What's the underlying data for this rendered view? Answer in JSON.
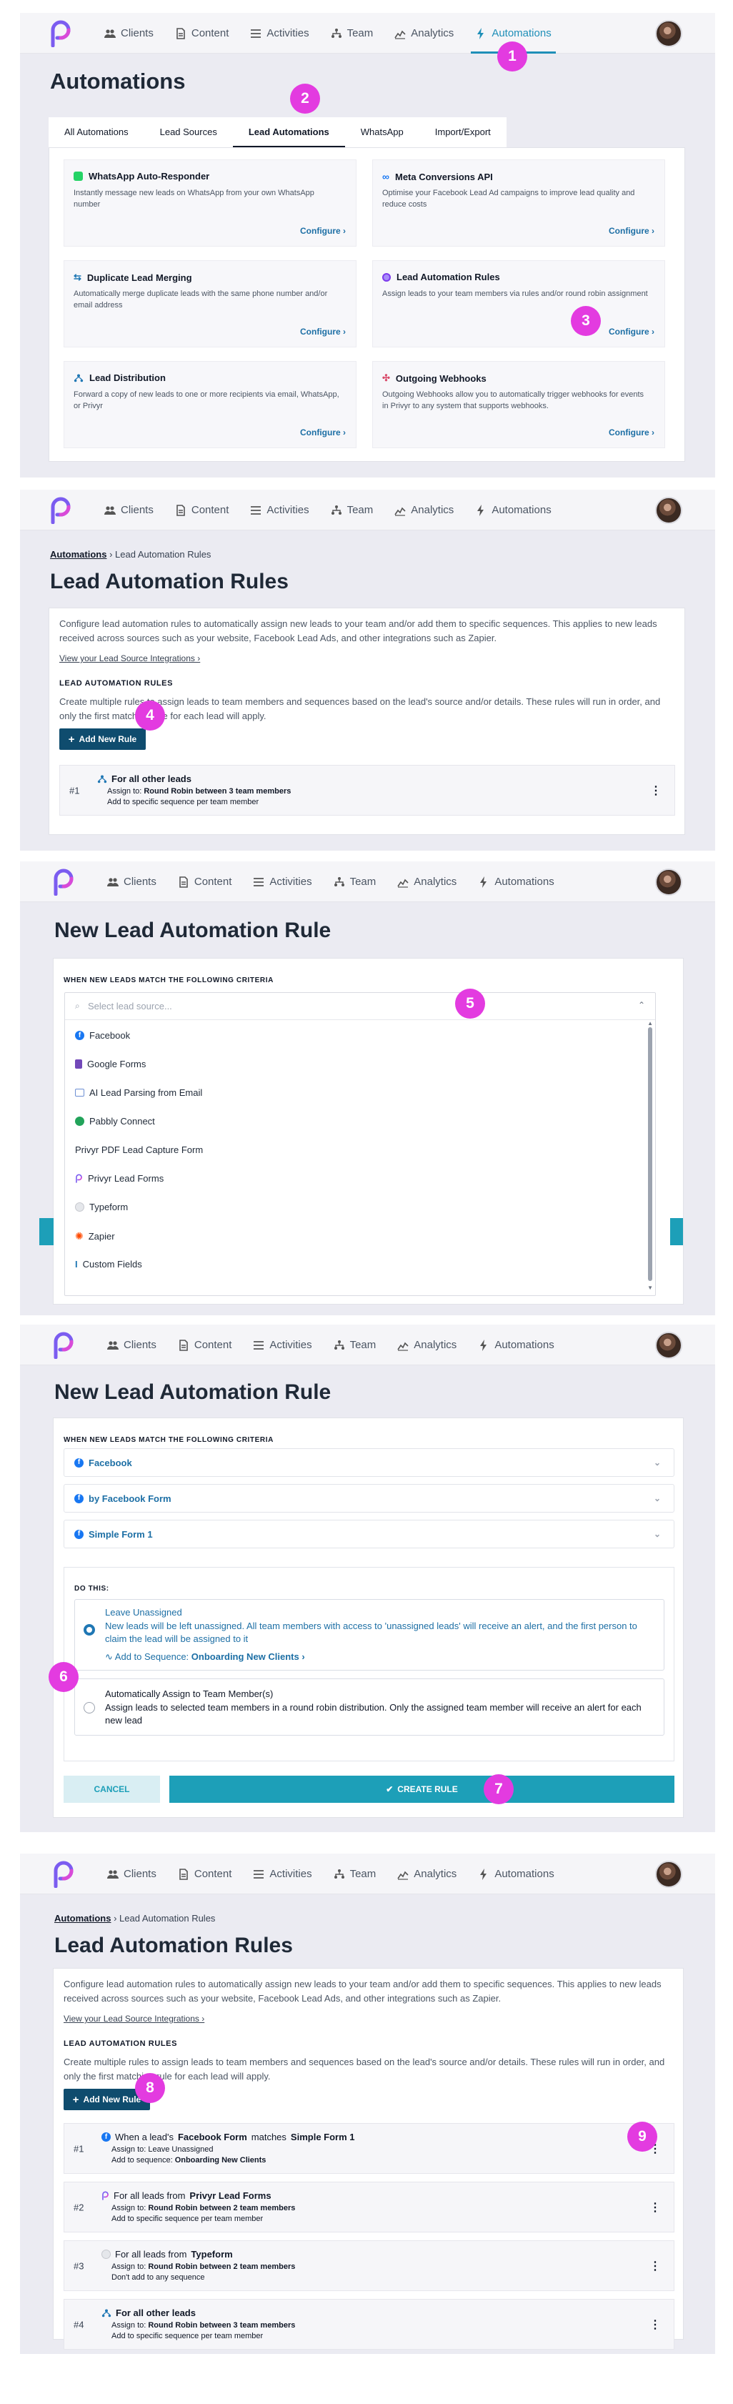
{
  "nav": {
    "items": [
      "Clients",
      "Content",
      "Activities",
      "Team",
      "Analytics",
      "Automations"
    ]
  },
  "screen1": {
    "title": "Automations",
    "tabs": [
      "All Automations",
      "Lead Sources",
      "Lead Automations",
      "WhatsApp",
      "Import/Export"
    ],
    "features": [
      {
        "title": "WhatsApp Auto-Responder",
        "desc": "Instantly message new leads on WhatsApp from your own WhatsApp number",
        "action": "Configure ›"
      },
      {
        "title": "Meta Conversions API",
        "desc": "Optimise your Facebook Lead Ad campaigns to improve lead quality and reduce costs",
        "action": "Configure ›"
      },
      {
        "title": "Duplicate Lead Merging",
        "desc": "Automatically merge duplicate leads with the same phone number and/or email address",
        "action": "Configure ›"
      },
      {
        "title": "Lead Automation Rules",
        "desc": "Assign leads to your team members via rules and/or round robin assignment",
        "action": "Configure ›"
      },
      {
        "title": "Lead Distribution",
        "desc": "Forward a copy of new leads to one or more recipients via email, WhatsApp, or Privyr",
        "action": "Configure ›"
      },
      {
        "title": "Outgoing Webhooks",
        "desc": "Outgoing Webhooks allow you to automatically trigger webhooks for events in Privyr to any system that supports webhooks.",
        "action": "Configure ›"
      }
    ]
  },
  "rules_page": {
    "crumb_root": "Automations",
    "crumb_current": " › Lead Automation Rules",
    "title": "Lead Automation Rules",
    "intro": "Configure lead automation rules to automatically assign new leads to your team and/or add them to specific sequences. This applies to new leads received across sources such as your website, Facebook Lead Ads, and other integrations such as Zapier.",
    "view_link": "View your Lead Source Integrations ›",
    "section_label": "LEAD AUTOMATION RULES",
    "section_desc": "Create multiple rules to assign leads to team members and sequences based on the lead's source and/or details. These rules will run in order, and only the first matching rule for each lead will apply.",
    "add_button": "Add New Rule"
  },
  "screen2": {
    "rules": [
      {
        "num": "#1",
        "title": "For all other leads",
        "assign_prefix": "Assign to: ",
        "assign": "Round Robin between 3 team members",
        "sequence": "Add to specific sequence per team member"
      }
    ]
  },
  "new_rule": {
    "title": "New Lead Automation Rule",
    "criteria_label": "WHEN NEW LEADS MATCH THE FOLLOWING CRITERIA",
    "select_placeholder": "Select lead source...",
    "sources": [
      "Facebook",
      "Google Forms",
      "AI Lead Parsing from Email",
      "Pabbly Connect",
      "Privyr PDF Lead Capture Form",
      "Privyr Lead Forms",
      "Typeform",
      "Zapier",
      "Custom Fields"
    ]
  },
  "screen4": {
    "selected": [
      "Facebook",
      "by Facebook Form",
      "Simple Form 1"
    ],
    "do_this": "DO THIS:",
    "option1_title": "Leave Unassigned",
    "option1_desc": "New leads will be left unassigned. All team members with access to 'unassigned leads' will receive an alert, and the first person to claim the lead will be assigned to it",
    "sequence_prefix": "Add to Sequence: ",
    "sequence_name": "Onboarding New Clients ›",
    "option2_title": "Automatically Assign to Team Member(s)",
    "option2_desc": "Assign leads to selected team members in a round robin distribution. Only the assigned team member will receive an alert for each new lead",
    "cancel": "CANCEL",
    "create": "CREATE RULE"
  },
  "screen5": {
    "rules": [
      {
        "num": "#1",
        "t1": "When a lead's ",
        "t2": "Facebook Form",
        "t3": " matches ",
        "t4": "Simple Form 1",
        "assign": "Assign to: Leave Unassigned",
        "seq_prefix": "Add to sequence: ",
        "seq": "Onboarding New Clients"
      },
      {
        "num": "#2",
        "t1": "For all leads from ",
        "t2": "Privyr Lead Forms",
        "assign_prefix": "Assign to: ",
        "assign": "Round Robin between 2 team members",
        "seq_text": "Add to specific sequence per team member"
      },
      {
        "num": "#3",
        "t1": "For all leads from ",
        "t2": "Typeform",
        "assign_prefix": "Assign to: ",
        "assign": "Round Robin between 2 team members",
        "seq_text": "Don't add to any sequence"
      },
      {
        "num": "#4",
        "t1": "For all other leads",
        "assign_prefix": "Assign to: ",
        "assign": "Round Robin between 3 team members",
        "seq_text": "Add to specific sequence per team member"
      }
    ]
  },
  "markers": [
    "1",
    "2",
    "3",
    "4",
    "5",
    "6",
    "7",
    "8",
    "9"
  ],
  "colors": {
    "accent": "#1f8fb8",
    "primary_button": "#0f4c6e",
    "create_button": "#1d9fb8",
    "marker": "#e33be0"
  }
}
